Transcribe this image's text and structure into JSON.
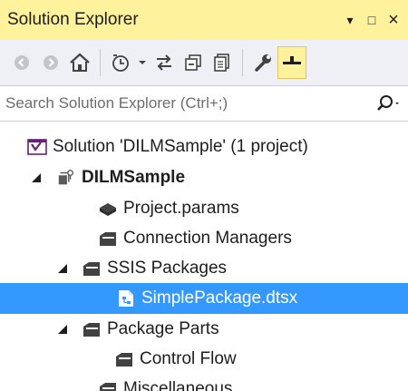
{
  "window": {
    "title": "Solution Explorer",
    "buttons": {
      "dropdown": "▾",
      "maximize": "□",
      "close": "×"
    }
  },
  "toolbar": {
    "items": [
      "back-icon",
      "forward-icon",
      "home-icon",
      "history-icon",
      "dropdown-icon",
      "sync-icon",
      "collapse-all-icon",
      "show-all-files-icon",
      "properties-icon",
      "preview-icon"
    ],
    "accent": "#fff29d"
  },
  "search": {
    "placeholder": "Search Solution Explorer (Ctrl+;)"
  },
  "tree": {
    "solution": "Solution 'DILMSample' (1 project)",
    "project": "DILMSample",
    "items": {
      "params": "Project.params",
      "connections": "Connection Managers",
      "ssis": "SSIS Packages",
      "package": "SimplePackage.dtsx",
      "parts": "Package Parts",
      "control_flow": "Control Flow",
      "misc": "Miscellaneous"
    }
  },
  "colors": {
    "title_bg": "#fff29d",
    "toolbar_bg": "#eef0f5",
    "selection": "#3399ff"
  }
}
